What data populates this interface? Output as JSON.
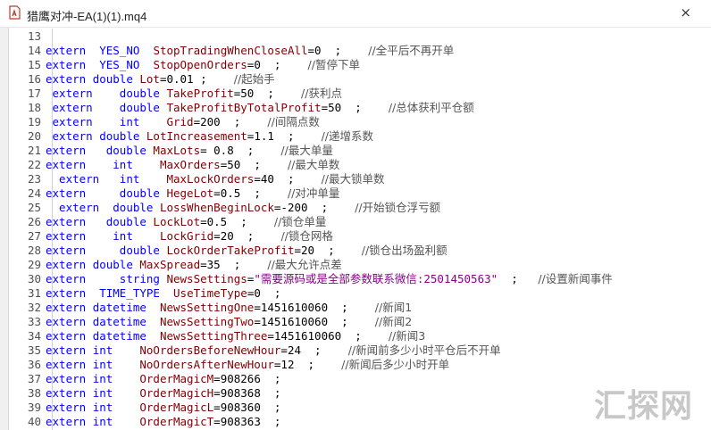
{
  "window": {
    "title": "猎鹰对冲-EA(1)(1).mq4",
    "close_glyph": "×"
  },
  "watermark": "汇探网",
  "lines": [
    {
      "n": "13",
      "parts": []
    },
    {
      "n": "14",
      "parts": [
        [
          "kw",
          "extern  "
        ],
        [
          "kw",
          "YES_NO  "
        ],
        [
          "id",
          "StopTradingWhenCloseAll"
        ],
        [
          "num",
          "=0  ;    "
        ],
        [
          "cm",
          "//全平后不再开单"
        ]
      ]
    },
    {
      "n": "15",
      "parts": [
        [
          "kw",
          "extern  "
        ],
        [
          "kw",
          "YES_NO  "
        ],
        [
          "id",
          "StopOpenOrders"
        ],
        [
          "num",
          "=0  ;    "
        ],
        [
          "cm",
          "//暂停下单"
        ]
      ]
    },
    {
      "n": "16",
      "parts": [
        [
          "kw",
          "extern "
        ],
        [
          "kw",
          "double "
        ],
        [
          "id",
          "Lot"
        ],
        [
          "num",
          "=0.01 ;    "
        ],
        [
          "cm",
          "//起始手"
        ]
      ]
    },
    {
      "n": "17",
      "parts": [
        [
          "kw",
          " extern    "
        ],
        [
          "kw",
          "double "
        ],
        [
          "id",
          "TakeProfit"
        ],
        [
          "num",
          "=50  ;    "
        ],
        [
          "cm",
          "//获利点"
        ]
      ]
    },
    {
      "n": "18",
      "parts": [
        [
          "kw",
          " extern    "
        ],
        [
          "kw",
          "double "
        ],
        [
          "id",
          "TakeProfitByTotalProfit"
        ],
        [
          "num",
          "=50  ;    "
        ],
        [
          "cm",
          "//总体获利平仓额"
        ]
      ]
    },
    {
      "n": "19",
      "parts": [
        [
          "kw",
          " extern    "
        ],
        [
          "kw",
          "int    "
        ],
        [
          "id",
          "Grid"
        ],
        [
          "num",
          "=200  ;    "
        ],
        [
          "cm",
          "//间隔点数"
        ]
      ]
    },
    {
      "n": "20",
      "parts": [
        [
          "kw",
          " extern "
        ],
        [
          "kw",
          "double "
        ],
        [
          "id",
          "LotIncreasement"
        ],
        [
          "num",
          "=1.1  ;    "
        ],
        [
          "cm",
          "//递增系数"
        ]
      ]
    },
    {
      "n": "21",
      "parts": [
        [
          "kw",
          "extern   "
        ],
        [
          "kw",
          "double "
        ],
        [
          "id",
          "MaxLots"
        ],
        [
          "num",
          "= 0.8  ;    "
        ],
        [
          "cm",
          "//最大单量"
        ]
      ]
    },
    {
      "n": "22",
      "parts": [
        [
          "kw",
          "extern    "
        ],
        [
          "kw",
          "int    "
        ],
        [
          "id",
          "MaxOrders"
        ],
        [
          "num",
          "=50  ;    "
        ],
        [
          "cm",
          "//最大单数"
        ]
      ]
    },
    {
      "n": "23",
      "parts": [
        [
          "kw",
          "  extern   "
        ],
        [
          "kw",
          "int    "
        ],
        [
          "id",
          "MaxLockOrders"
        ],
        [
          "num",
          "=40  ;    "
        ],
        [
          "cm",
          "//最大锁单数"
        ]
      ]
    },
    {
      "n": "24",
      "parts": [
        [
          "kw",
          "extern     "
        ],
        [
          "kw",
          "double "
        ],
        [
          "id",
          "HegeLot"
        ],
        [
          "num",
          "=0.5  ;    "
        ],
        [
          "cm",
          "//对冲单量"
        ]
      ]
    },
    {
      "n": "25",
      "parts": [
        [
          "kw",
          "  extern  "
        ],
        [
          "kw",
          "double "
        ],
        [
          "id",
          "LossWhenBeginLock"
        ],
        [
          "num",
          "=-200  ;    "
        ],
        [
          "cm",
          "//开始锁仓浮亏额"
        ]
      ]
    },
    {
      "n": "26",
      "parts": [
        [
          "kw",
          "extern   "
        ],
        [
          "kw",
          "double "
        ],
        [
          "id",
          "LockLot"
        ],
        [
          "num",
          "=0.5  ;    "
        ],
        [
          "cm",
          "//锁仓单量"
        ]
      ]
    },
    {
      "n": "27",
      "parts": [
        [
          "kw",
          "extern    "
        ],
        [
          "kw",
          "int    "
        ],
        [
          "id",
          "LockGrid"
        ],
        [
          "num",
          "=20  ;    "
        ],
        [
          "cm",
          "//锁仓网格"
        ]
      ]
    },
    {
      "n": "28",
      "parts": [
        [
          "kw",
          "extern     "
        ],
        [
          "kw",
          "double "
        ],
        [
          "id",
          "LockOrderTakeProfit"
        ],
        [
          "num",
          "=20  ;    "
        ],
        [
          "cm",
          "//锁仓出场盈利额"
        ]
      ]
    },
    {
      "n": "29",
      "parts": [
        [
          "kw",
          "extern "
        ],
        [
          "kw",
          "double "
        ],
        [
          "id",
          "MaxSpread"
        ],
        [
          "num",
          "=35  ;    "
        ],
        [
          "cm",
          "//最大允许点差"
        ]
      ]
    },
    {
      "n": "30",
      "parts": [
        [
          "kw",
          "extern     "
        ],
        [
          "kw",
          "string "
        ],
        [
          "id",
          "NewsSettings"
        ],
        [
          "num",
          "="
        ],
        [
          "str",
          "\"需要源码或是全部参数联系微信:2501450563\""
        ],
        [
          "num",
          "  ;   "
        ],
        [
          "cm",
          "//设置新闻事件"
        ]
      ]
    },
    {
      "n": "31",
      "parts": [
        [
          "kw",
          "extern  "
        ],
        [
          "kw",
          "TIME_TYPE  "
        ],
        [
          "id",
          "UseTimeType"
        ],
        [
          "num",
          "=0  ;"
        ]
      ]
    },
    {
      "n": "32",
      "parts": [
        [
          "kw",
          "extern "
        ],
        [
          "kw",
          "datetime  "
        ],
        [
          "id",
          "NewsSettingOne"
        ],
        [
          "num",
          "=1451610060  ;    "
        ],
        [
          "cm",
          "//新闻1"
        ]
      ]
    },
    {
      "n": "33",
      "parts": [
        [
          "kw",
          "extern "
        ],
        [
          "kw",
          "datetime  "
        ],
        [
          "id",
          "NewsSettingTwo"
        ],
        [
          "num",
          "=1451610060  ;    "
        ],
        [
          "cm",
          "//新闻2"
        ]
      ]
    },
    {
      "n": "34",
      "parts": [
        [
          "kw",
          "extern "
        ],
        [
          "kw",
          "datetime  "
        ],
        [
          "id",
          "NewsSettingThree"
        ],
        [
          "num",
          "=1451610060  ;    "
        ],
        [
          "cm",
          "//新闻3"
        ]
      ]
    },
    {
      "n": "35",
      "parts": [
        [
          "kw",
          "extern "
        ],
        [
          "kw",
          "int    "
        ],
        [
          "id",
          "NoOrdersBeforeNewHour"
        ],
        [
          "num",
          "=24  ;    "
        ],
        [
          "cm",
          "//新闻前多少小时平仓后不开单"
        ]
      ]
    },
    {
      "n": "36",
      "parts": [
        [
          "kw",
          "extern "
        ],
        [
          "kw",
          "int    "
        ],
        [
          "id",
          "NoOrdersAfterNewHour"
        ],
        [
          "num",
          "=12  ;    "
        ],
        [
          "cm",
          "//新闻后多少小时开单"
        ]
      ]
    },
    {
      "n": "37",
      "parts": [
        [
          "kw",
          "extern "
        ],
        [
          "kw",
          "int    "
        ],
        [
          "id",
          "OrderMagicM"
        ],
        [
          "num",
          "=908266  ;"
        ]
      ]
    },
    {
      "n": "38",
      "parts": [
        [
          "kw",
          "extern "
        ],
        [
          "kw",
          "int    "
        ],
        [
          "id",
          "OrderMagicH"
        ],
        [
          "num",
          "=908368  ;"
        ]
      ]
    },
    {
      "n": "39",
      "parts": [
        [
          "kw",
          "extern "
        ],
        [
          "kw",
          "int    "
        ],
        [
          "id",
          "OrderMagicL"
        ],
        [
          "num",
          "=908360  ;"
        ]
      ]
    },
    {
      "n": "40",
      "parts": [
        [
          "kw",
          "extern "
        ],
        [
          "kw",
          "int    "
        ],
        [
          "id",
          "OrderMagicT"
        ],
        [
          "num",
          "=908363  ;"
        ]
      ]
    }
  ]
}
